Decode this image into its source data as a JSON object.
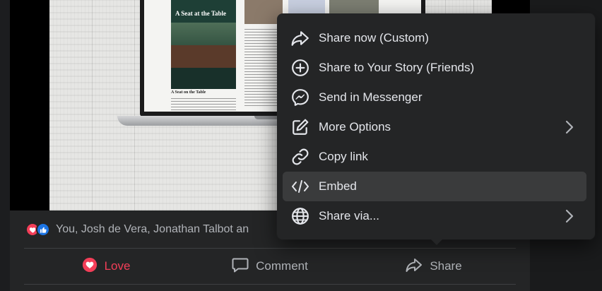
{
  "post": {
    "reactions_text": "You, Josh de Vera, Jonathan Talbot an",
    "reaction_icons": [
      "love-icon",
      "like-icon"
    ],
    "actions": [
      {
        "label": "Love",
        "icon": "heart-icon"
      },
      {
        "label": "Comment",
        "icon": "comment-icon"
      },
      {
        "label": "Share",
        "icon": "share-icon"
      }
    ]
  },
  "media": {
    "magazine_title": "A Seat at the Table",
    "magazine_caption": "A Seat on the Table"
  },
  "share_menu": {
    "items": [
      {
        "label": "Share now (Custom)",
        "icon": "share-arrow-icon",
        "has_submenu": false
      },
      {
        "label": "Share to Your Story (Friends)",
        "icon": "plus-circle-icon",
        "has_submenu": false
      },
      {
        "label": "Send in Messenger",
        "icon": "messenger-icon",
        "has_submenu": false
      },
      {
        "label": "More Options",
        "icon": "edit-icon",
        "has_submenu": true
      },
      {
        "label": "Copy link",
        "icon": "link-icon",
        "has_submenu": false
      },
      {
        "label": "Embed",
        "icon": "code-icon",
        "has_submenu": false,
        "selected": true
      },
      {
        "label": "Share via...",
        "icon": "globe-icon",
        "has_submenu": true
      }
    ]
  },
  "colors": {
    "background": "#18191a",
    "card": "#242526",
    "menu": "#242526",
    "menu_hover": "#3a3b3c",
    "text_primary": "#e4e6eb",
    "text_secondary": "#b0b3b8",
    "love": "#f33e58",
    "like": "#1b74e4"
  }
}
